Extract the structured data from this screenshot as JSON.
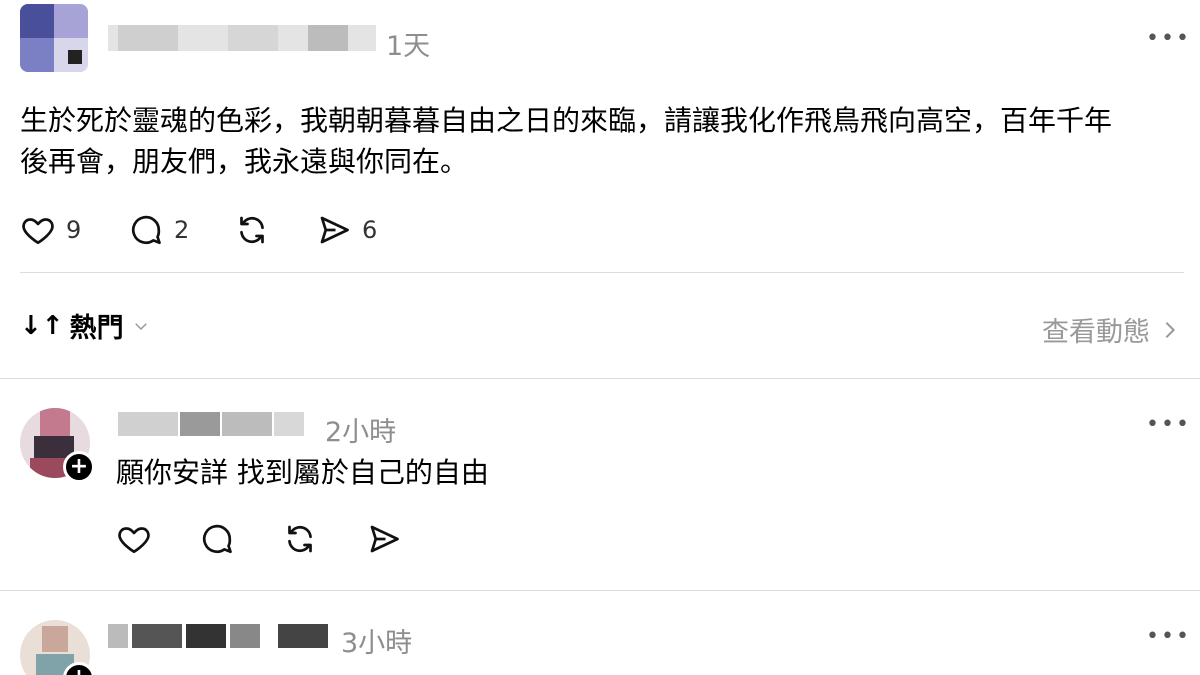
{
  "post": {
    "time": "1天",
    "text_line1": "生於死於靈魂的色彩，我朝朝暮暮自由之日的來臨，請讓我化作飛鳥飛向高空，百年千年",
    "text_line2": "後再會，朋友們，我永遠與你同在。",
    "more_icon": "more-horizontal-icon",
    "actions": {
      "like_count": "9",
      "comment_count": "2",
      "share_count": "6"
    }
  },
  "sort_bar": {
    "label": "熱門",
    "view_activity": "查看動態"
  },
  "replies": [
    {
      "time": "2小時",
      "text": "願你安詳 找到屬於自己的自由"
    },
    {
      "time": "3小時"
    }
  ],
  "colors": {
    "muted": "#8e8e8e",
    "divider": "#dcdcdc",
    "text": "#000000"
  }
}
